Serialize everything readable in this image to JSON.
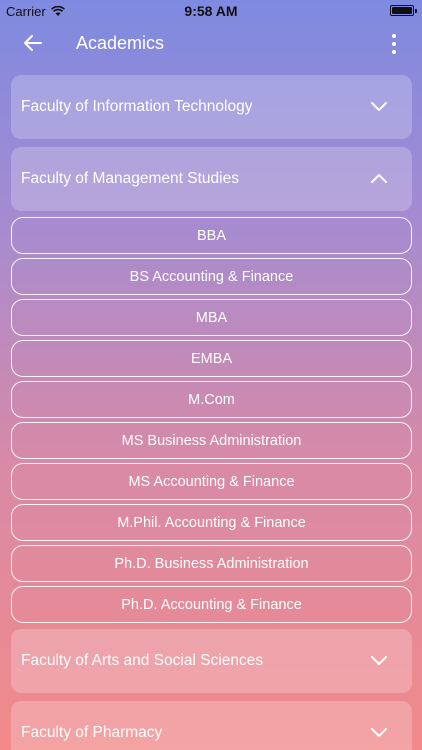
{
  "status_bar": {
    "carrier": "Carrier",
    "time": "9:58 AM"
  },
  "appbar": {
    "title": "Academics"
  },
  "faculties": [
    {
      "label": "Faculty of Information Technology"
    },
    {
      "label": "Faculty of Management Studies"
    },
    {
      "label": "Faculty of Arts and Social Sciences"
    },
    {
      "label": "Faculty of Pharmacy"
    }
  ],
  "programs": [
    "BBA",
    "BS Accounting & Finance",
    "MBA",
    "EMBA",
    "M.Com",
    "MS Business Administration",
    "MS Accounting & Finance",
    "M.Phil. Accounting & Finance",
    "Ph.D. Business Administration",
    "Ph.D. Accounting & Finance"
  ],
  "icons": {
    "back": "arrow-left-icon",
    "menu": "more-vertical-icon",
    "expand": "chevron-down-icon",
    "collapse": "chevron-up-icon"
  }
}
